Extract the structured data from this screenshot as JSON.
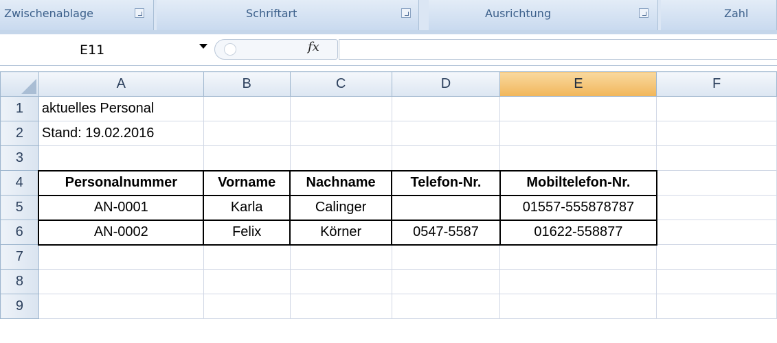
{
  "ribbon": {
    "groups": [
      {
        "label": "Zwischenablage"
      },
      {
        "label": "Schriftart"
      },
      {
        "label": "Ausrichtung"
      },
      {
        "label": "Zahl"
      }
    ]
  },
  "formula_bar": {
    "name_box": "E11",
    "fx_label": "fx",
    "formula": ""
  },
  "columns": [
    "A",
    "B",
    "C",
    "D",
    "E",
    "F"
  ],
  "active_column": "E",
  "rows": [
    {
      "num": "1",
      "cells": [
        "aktuelles Personal",
        "",
        "",
        "",
        "",
        ""
      ]
    },
    {
      "num": "2",
      "cells": [
        "Stand: 19.02.2016",
        "",
        "",
        "",
        "",
        ""
      ]
    },
    {
      "num": "3",
      "cells": [
        "",
        "",
        "",
        "",
        "",
        ""
      ]
    },
    {
      "num": "4",
      "cells": [
        "Personalnummer",
        "Vorname",
        "Nachname",
        "Telefon-Nr.",
        "Mobiltelefon-Nr.",
        ""
      ]
    },
    {
      "num": "5",
      "cells": [
        "AN-0001",
        "Karla",
        "Calinger",
        "",
        "01557-555878787",
        ""
      ]
    },
    {
      "num": "6",
      "cells": [
        "AN-0002",
        "Felix",
        "Körner",
        "0547-5587",
        "01622-558877",
        ""
      ]
    },
    {
      "num": "7",
      "cells": [
        "",
        "",
        "",
        "",
        "",
        ""
      ]
    },
    {
      "num": "8",
      "cells": [
        "",
        "",
        "",
        "",
        "",
        ""
      ]
    },
    {
      "num": "9",
      "cells": [
        "",
        "",
        "",
        "",
        "",
        ""
      ]
    }
  ]
}
